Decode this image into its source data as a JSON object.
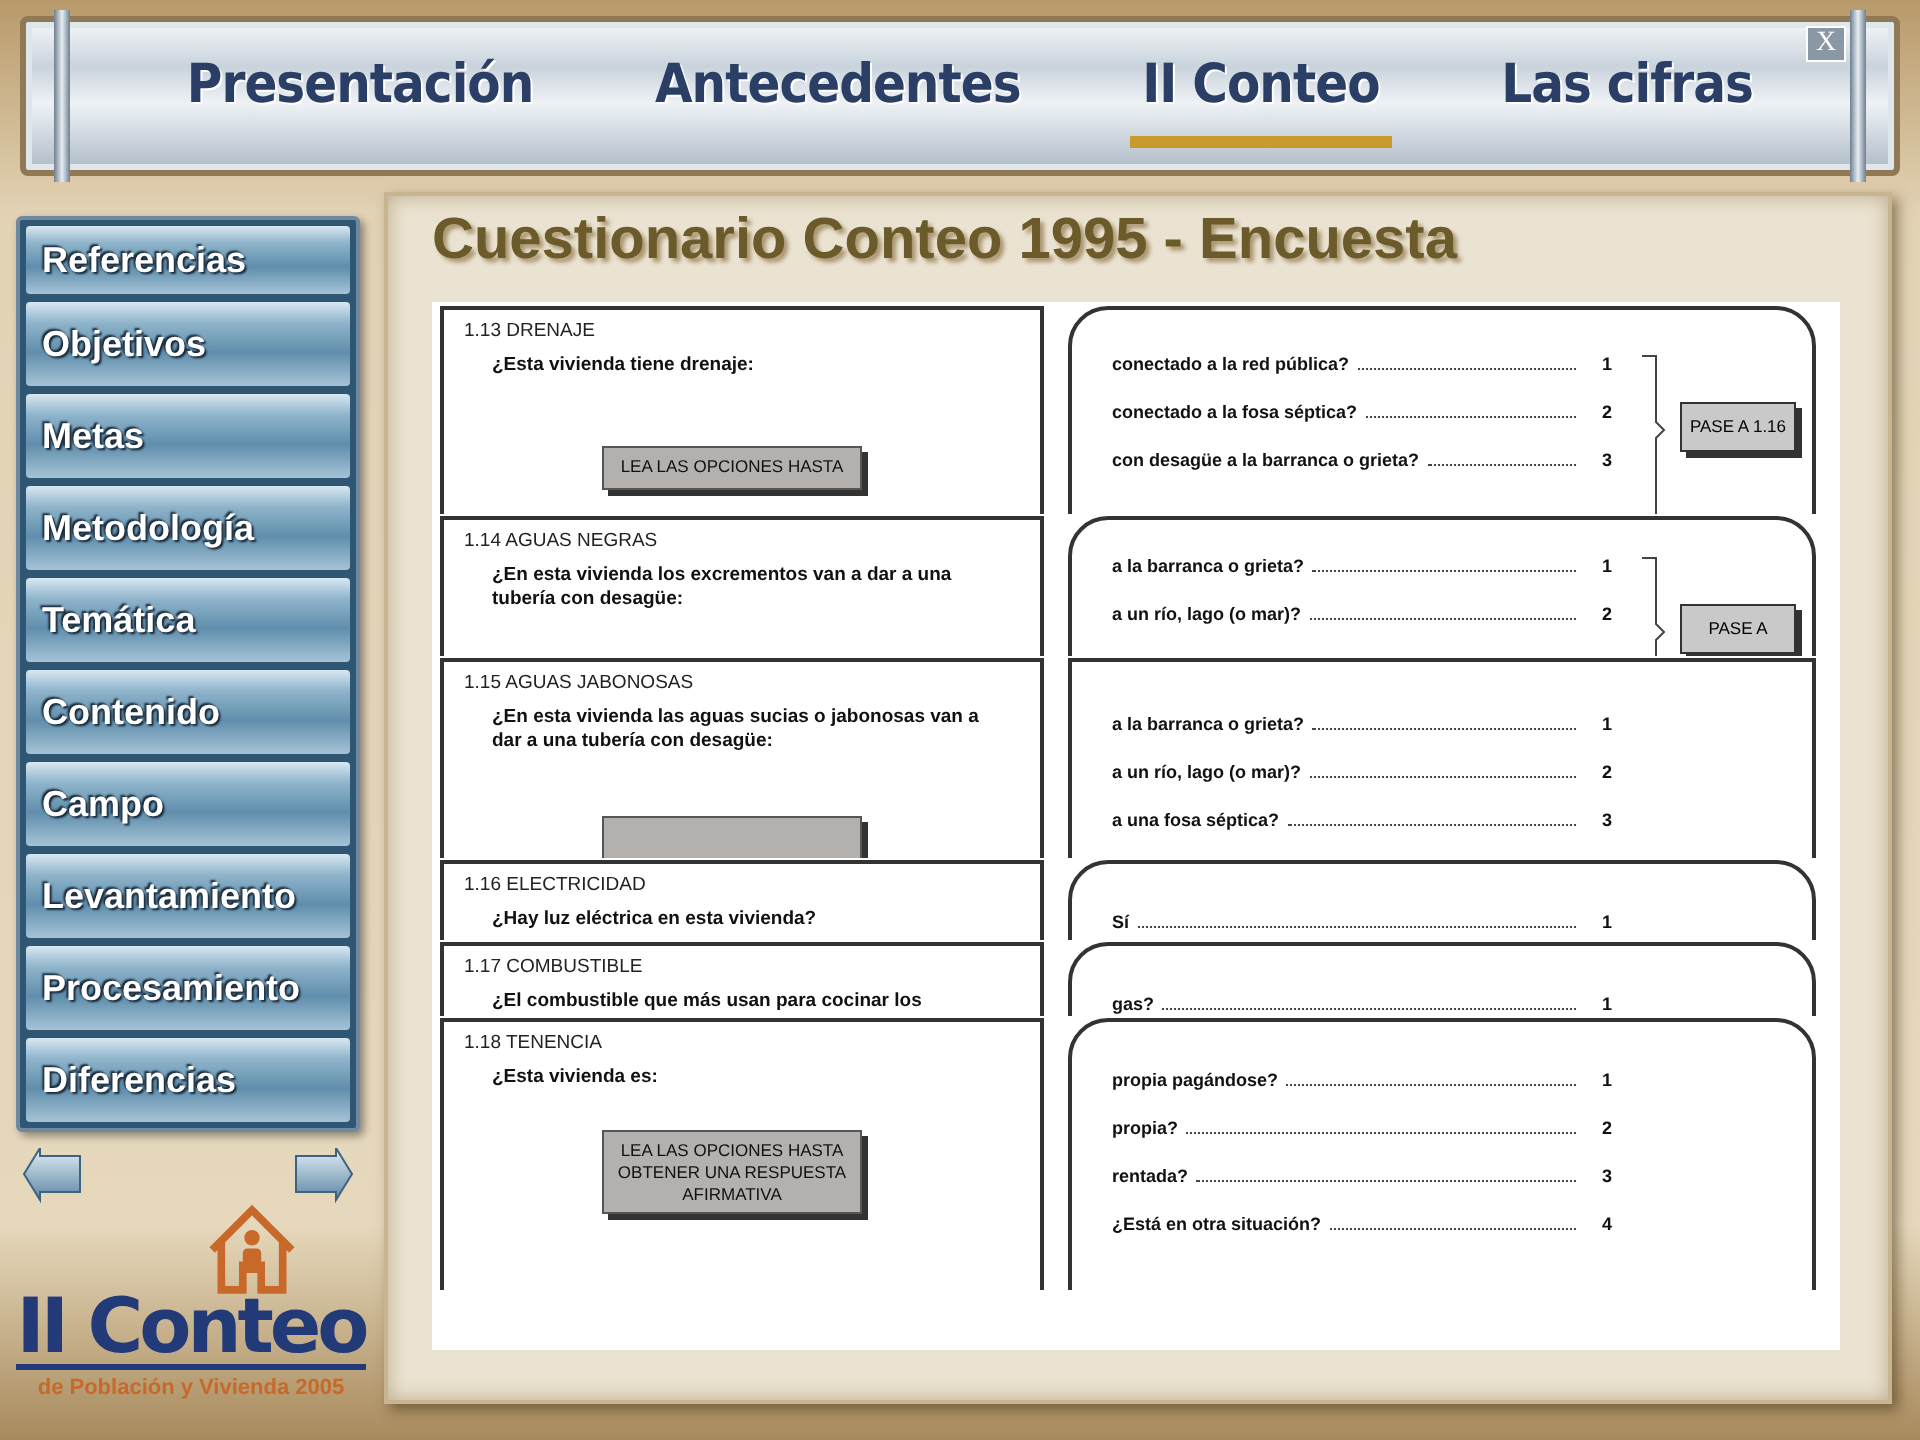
{
  "nav": {
    "tabs": [
      {
        "label": "Presentación",
        "selected": false
      },
      {
        "label": "Antecedentes",
        "selected": false
      },
      {
        "label": "II Conteo",
        "selected": true
      },
      {
        "label": "Las cifras",
        "selected": false
      }
    ],
    "close": "X"
  },
  "sidebar": {
    "items": [
      "Referencias",
      "Objetivos",
      "Metas",
      "Metodología",
      "Temática",
      "Contenido",
      "Campo",
      "Levantamiento",
      "Procesamiento",
      "Diferencias"
    ]
  },
  "logo": {
    "title": "II Conteo",
    "subtitle": "de Población y Vivienda 2005"
  },
  "page_title": "Cuestionario Conteo 1995 - Encuesta",
  "questionnaire": {
    "sections": [
      {
        "heading": "1.13 DRENAJE",
        "question": "¿Esta vivienda tiene drenaje:",
        "instruction_box": true,
        "instruction": "LEA LAS OPCIONES HASTA",
        "kind": "rounded",
        "options": [
          {
            "label": "conectado a la red pública?",
            "code": "1"
          },
          {
            "label": "conectado a la fosa séptica?",
            "code": "2"
          },
          {
            "label": "con desagüe a la barranca o grieta?",
            "code": "3"
          }
        ],
        "jump": "PASE A 1.16"
      },
      {
        "heading": "1.14 AGUAS NEGRAS",
        "question": "¿En esta vivienda los excrementos van a dar a una tubería con desagüe:",
        "instruction_box": false,
        "kind": "rounded",
        "options": [
          {
            "label": "a la barranca o grieta?",
            "code": "1"
          },
          {
            "label": "a un río, lago (o mar)?",
            "code": "2"
          }
        ],
        "jump": "PASE A"
      },
      {
        "heading": "1.15 AGUAS JABONOSAS",
        "question": "¿En esta vivienda las aguas sucias o jabonosas van a dar a una tubería con desagüe:",
        "instruction_box": true,
        "kind": "square",
        "options": [
          {
            "label": "a la barranca o grieta?",
            "code": "1"
          },
          {
            "label": "a un río, lago (o mar)?",
            "code": "2"
          },
          {
            "label": "a una fosa séptica?",
            "code": "3"
          }
        ]
      },
      {
        "heading": "1.16 ELECTRICIDAD",
        "question": "¿Hay luz eléctrica en esta vivienda?",
        "instruction_box": false,
        "kind": "rounded",
        "options": [
          {
            "label": "Sí",
            "code": "1"
          }
        ]
      },
      {
        "heading": "1.17 COMBUSTIBLE",
        "question": "¿El combustible que más usan para cocinar los",
        "instruction_box": false,
        "kind": "rounded",
        "options": [
          {
            "label": "gas?",
            "code": "1"
          }
        ]
      },
      {
        "heading": "1.18 TENENCIA",
        "question": "¿Esta vivienda es:",
        "instruction_box": true,
        "instruction": "LEA LAS OPCIONES HASTA OBTENER UNA RESPUESTA AFIRMATIVA",
        "kind": "rounded",
        "options": [
          {
            "label": "propia pagándose?",
            "code": "1"
          },
          {
            "label": "propia?",
            "code": "2"
          },
          {
            "label": "rentada?",
            "code": "3"
          },
          {
            "label": "¿Está en otra situación?",
            "code": "4"
          }
        ]
      }
    ]
  }
}
